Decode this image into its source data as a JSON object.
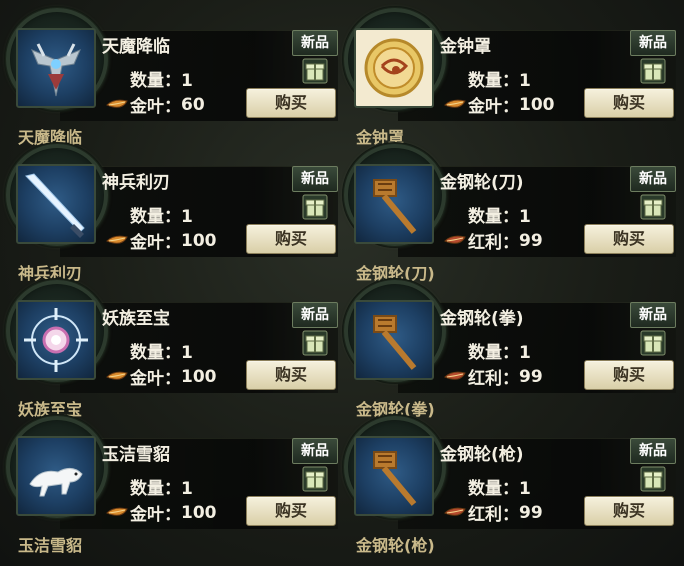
{
  "ui": {
    "new_badge": "新品",
    "buy_label": "购买",
    "qty_label": "数量："
  },
  "items": [
    {
      "name": "天魔降临",
      "caption": "天魔降临",
      "qty": "1",
      "currency": "金叶：",
      "currency_icon": "gold-leaf-icon",
      "price": "60",
      "icon": "demon-armor-icon"
    },
    {
      "name": "金钟罩",
      "caption": "金钟罩",
      "qty": "1",
      "currency": "金叶：",
      "currency_icon": "gold-leaf-icon",
      "price": "100",
      "icon": "golden-bell-icon"
    },
    {
      "name": "神兵利刃",
      "caption": "神兵利刃",
      "qty": "1",
      "currency": "金叶：",
      "currency_icon": "gold-leaf-icon",
      "price": "100",
      "icon": "blade-icon"
    },
    {
      "name": "金钢轮(刀)",
      "caption": "金钢轮(刀)",
      "qty": "1",
      "currency": "红利：",
      "currency_icon": "red-leaf-icon",
      "price": "99",
      "icon": "hammer-icon"
    },
    {
      "name": "妖族至宝",
      "caption": "妖族至宝",
      "qty": "1",
      "currency": "金叶：",
      "currency_icon": "gold-leaf-icon",
      "price": "100",
      "icon": "demon-treasure-icon"
    },
    {
      "name": "金钢轮(拳)",
      "caption": "金钢轮(拳)",
      "qty": "1",
      "currency": "红利：",
      "currency_icon": "red-leaf-icon",
      "price": "99",
      "icon": "hammer-icon"
    },
    {
      "name": "玉洁雪貂",
      "caption": "玉洁雪貂",
      "qty": "1",
      "currency": "金叶：",
      "currency_icon": "gold-leaf-icon",
      "price": "100",
      "icon": "snow-mink-icon"
    },
    {
      "name": "金钢轮(枪)",
      "caption": "金钢轮(枪)",
      "qty": "1",
      "currency": "红利：",
      "currency_icon": "red-leaf-icon",
      "price": "99",
      "icon": "hammer-icon"
    }
  ],
  "colors": {
    "gold_leaf": "#d98a2c",
    "red_leaf": "#b64b2e",
    "caption": "#c9b98a"
  }
}
